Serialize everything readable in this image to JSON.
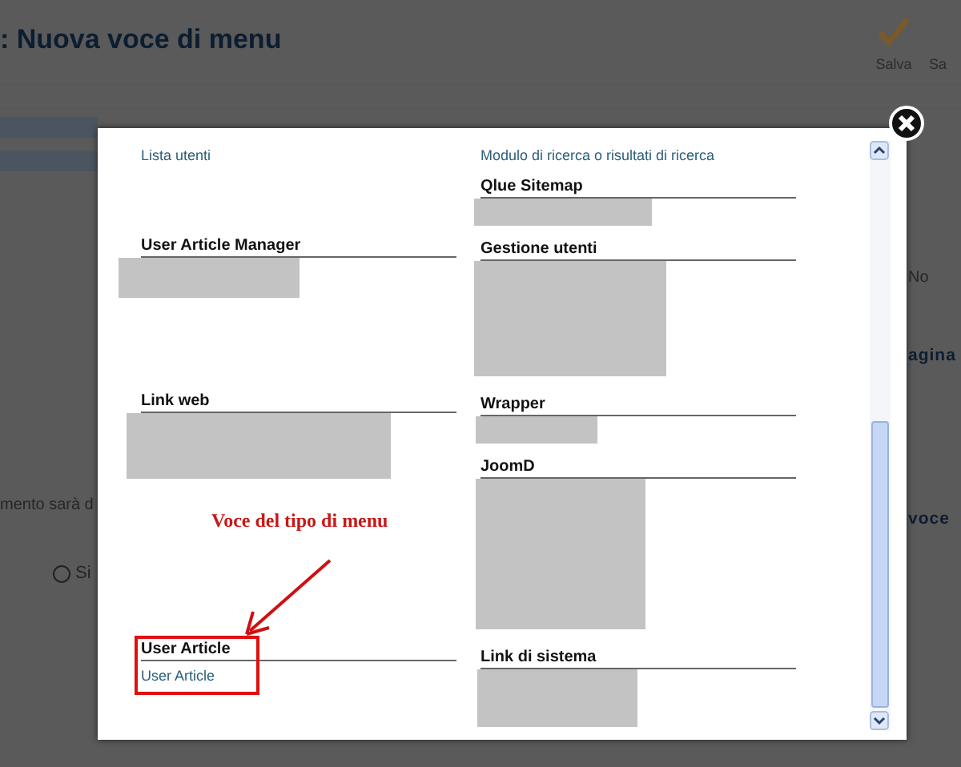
{
  "page": {
    "title": ": Nuova voce di menu",
    "toolbar": [
      {
        "label": "Salva",
        "kind": "save"
      },
      {
        "label": "Sa",
        "kind": "plain"
      }
    ],
    "left_fragments": [
      {
        "text": "mento sarà d",
        "kind": "text"
      },
      {
        "text": "Si",
        "kind": "radio",
        "checked": false
      }
    ],
    "right_fragments": [
      {
        "text": "No",
        "kind": "text"
      },
      {
        "text": "agina",
        "kind": "heading"
      },
      {
        "text": "voce",
        "kind": "heading"
      }
    ]
  },
  "modal": {
    "columns": [
      [
        {
          "links": [
            "Lista utenti"
          ]
        },
        {
          "heading": "User Article Manager",
          "redacted": true
        },
        {
          "heading": "Link web",
          "redacted": true
        },
        {
          "annotation": "Voce del tipo di menu"
        },
        {
          "heading": "User Article",
          "links": [
            "User Article"
          ],
          "highlighted": true
        }
      ],
      [
        {
          "links": [
            "Modulo di ricerca o risultati di ricerca"
          ]
        },
        {
          "heading": "Qlue Sitemap",
          "redacted": true
        },
        {
          "heading": "Gestione utenti",
          "redacted": true
        },
        {
          "heading": "Wrapper",
          "redacted": true
        },
        {
          "heading": "JoomD",
          "redacted": true
        },
        {
          "heading": "Link di sistema",
          "redacted": true
        }
      ]
    ]
  }
}
